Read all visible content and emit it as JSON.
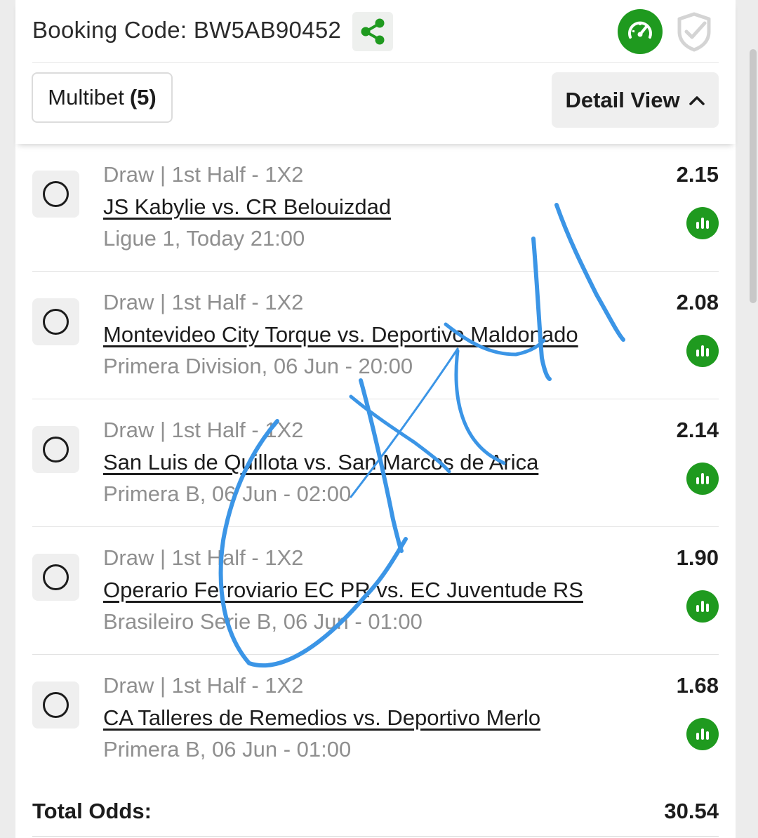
{
  "header": {
    "booking_label": "Booking Code:",
    "booking_code": "BW5AB90452",
    "share_icon": "share-icon",
    "speed_icon": "speedometer-icon",
    "shield_icon": "shield-check-icon"
  },
  "controls": {
    "multibet_label": "Multibet",
    "multibet_count": "(5)",
    "detail_view_label": "Detail View",
    "detail_view_icon": "chevron-up-icon"
  },
  "selections": [
    {
      "market": "Draw | 1st Half - 1X2",
      "match": "JS Kabylie vs. CR Belouizdad",
      "league": "Ligue 1, Today 21:00",
      "odds": "2.15"
    },
    {
      "market": "Draw | 1st Half - 1X2",
      "match": "Montevideo City Torque vs. Deportivo Maldonado",
      "league": "Primera Division, 06 Jun - 20:00",
      "odds": "2.08"
    },
    {
      "market": "Draw | 1st Half - 1X2",
      "match": "San Luis de Quillota vs. San Marcos de Arica",
      "league": "Primera B, 06 Jun - 02:00",
      "odds": "2.14"
    },
    {
      "market": "Draw | 1st Half - 1X2",
      "match": "Operario Ferroviario EC PR vs. EC Juventude RS",
      "league": "Brasileiro Serie B, 06 Jun - 01:00",
      "odds": "1.90"
    },
    {
      "market": "Draw | 1st Half - 1X2",
      "match": "CA Talleres de Remedios vs. Deportivo Merlo",
      "league": "Primera B, 06 Jun - 01:00",
      "odds": "1.68"
    }
  ],
  "total": {
    "label": "Total Odds:",
    "value": "30.54"
  },
  "colors": {
    "accent_green": "#1f9a1f",
    "muted_text": "#8f8f8f",
    "scribble_blue": "#3b95e6"
  }
}
